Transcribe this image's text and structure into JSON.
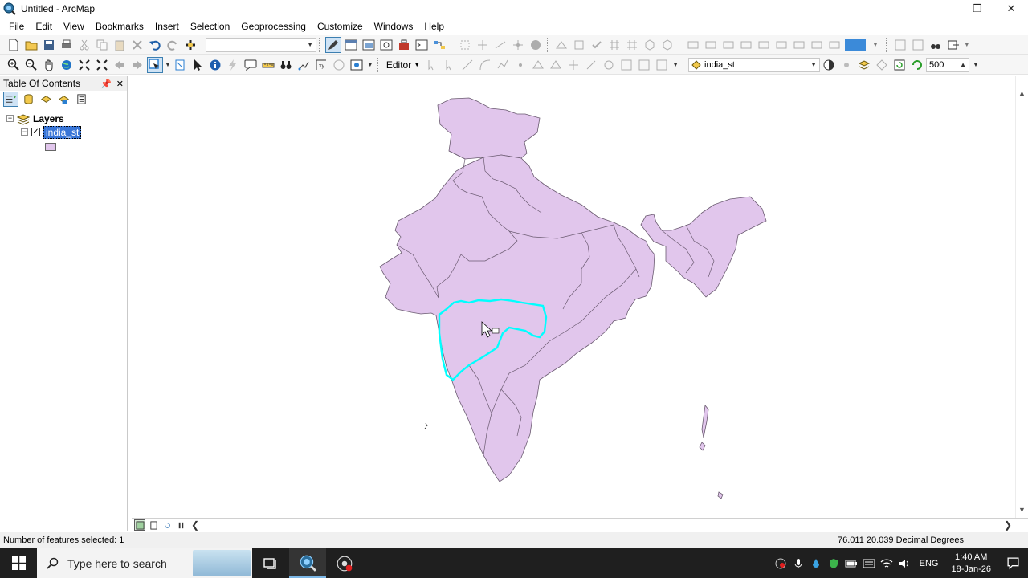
{
  "window": {
    "title": "Untitled - ArcMap"
  },
  "menu": {
    "items": [
      "File",
      "Edit",
      "View",
      "Bookmarks",
      "Insert",
      "Selection",
      "Geoprocessing",
      "Customize",
      "Windows",
      "Help"
    ]
  },
  "toolbar": {
    "editor_label": "Editor",
    "target_layer": "india_st",
    "scale_value": "500"
  },
  "toc": {
    "title": "Table Of Contents",
    "root_label": "Layers",
    "layer_name": "india_st",
    "layer_checked": true,
    "symbol_color": "#e1c6ec"
  },
  "map": {
    "fill_color": "#e1c6ec",
    "stroke_color": "#6a5a70",
    "selection_color": "#00ffff"
  },
  "status": {
    "selection_text": "Number of features selected: 1",
    "coordinates": "76.011  20.039 Decimal Degrees"
  },
  "taskbar": {
    "search_placeholder": "Type here to search",
    "language": "ENG",
    "time": "1:40 AM",
    "date": "18-Jan-26"
  }
}
